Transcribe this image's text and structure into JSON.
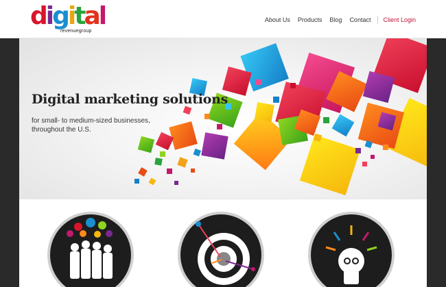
{
  "brand": {
    "logo_text": "digital",
    "tagline": "revenuegroup"
  },
  "nav": {
    "items": [
      {
        "label": "About Us"
      },
      {
        "label": "Products"
      },
      {
        "label": "Blog"
      },
      {
        "label": "Contact"
      }
    ],
    "login_label": "Client Login"
  },
  "hero": {
    "title": "Digital marketing solutions",
    "subtitle": "for small- to medium-sized businesses, throughout the U.S."
  },
  "features": [
    {
      "icon": "people-speech-bubbles-icon"
    },
    {
      "icon": "target-with-darts-icon"
    },
    {
      "icon": "lightbulb-idea-icon"
    }
  ],
  "colors": {
    "accent": "#c0163c",
    "nav_text": "#333333",
    "dark_bg": "#262626"
  }
}
